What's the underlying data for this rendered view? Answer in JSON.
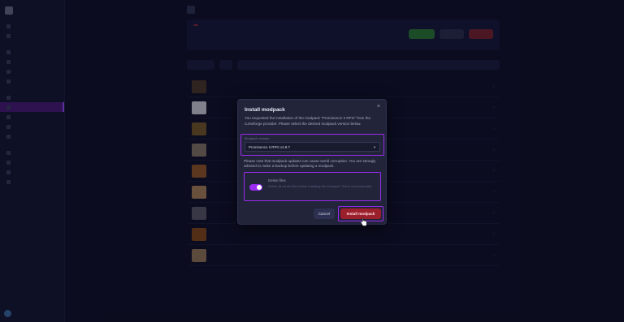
{
  "colors": {
    "accent_purple": "#9a2bf0",
    "install_red": "#9c1f2c",
    "modal_bg": "#22243a"
  },
  "modal": {
    "title": "Install modpack",
    "close_icon": "×",
    "intro": "You requested the installation of the modpack \"Prominence II RPG\" from the curseforge provider. Please select the desired modpack version below.",
    "version_label": "Modpack version",
    "version_value": "Prominence II RPG v2.8.7",
    "warning": "Please note that modpack updates can cause world corruption. You are strongly advised to make a backup before updating a modpack.",
    "toggle_title": "Delete files",
    "toggle_desc": "Delete all server files before installing the modpack. This is recommended.",
    "toggle_on": true,
    "cancel_label": "Cancel",
    "install_label": "Install modpack"
  }
}
